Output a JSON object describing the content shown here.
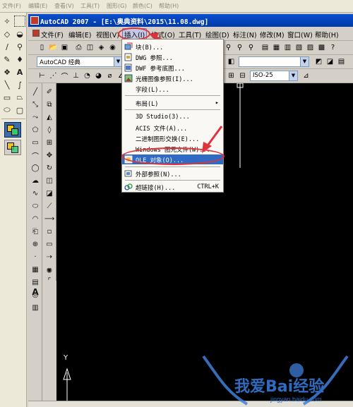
{
  "host": {
    "menu": [
      "文件(F)",
      "编辑(E)",
      "查看(V)",
      "工具(T)",
      "图形(G)",
      "颜色(C)",
      "帮助(H)"
    ]
  },
  "window": {
    "title": "AutoCAD 2007 - [E:\\奥典资料\\2015\\11.08.dwg]"
  },
  "menubar": {
    "items": [
      "文件(F)",
      "编辑(E)",
      "视图(V)",
      "插入(I)",
      "格式(O)",
      "工具(T)",
      "绘图(D)",
      "标注(N)",
      "修改(M)",
      "窗口(W)",
      "帮助(H)"
    ],
    "active_index": 3
  },
  "toolbar": {
    "workspace": "AutoCAD 经典",
    "dimstyle": "ISO-25"
  },
  "insert_menu": {
    "items": [
      {
        "label": "块(B)...",
        "icon": "block-icon"
      },
      {
        "label": "DWG 参照...",
        "icon": "dwg-reference-icon"
      },
      {
        "label": "DWF 参考底图...",
        "icon": "dwf-underlay-icon"
      },
      {
        "label": "光栅图像参照(I)...",
        "icon": "raster-image-icon"
      },
      {
        "label": "字段(L)...",
        "icon": ""
      },
      {
        "label": "布局(L)",
        "icon": "",
        "submenu": true
      },
      {
        "label": "3D Studio(3)...",
        "icon": ""
      },
      {
        "label": "ACIS 文件(A)...",
        "icon": ""
      },
      {
        "label": "二进制图形交换(E)...",
        "icon": ""
      },
      {
        "label": "Windows 图元文件(W)...",
        "icon": ""
      },
      {
        "label": "OLE 对象(O)...",
        "icon": "ole-object-icon",
        "selected": true
      },
      {
        "label": "外部参照(N)...",
        "icon": "xref-icon"
      },
      {
        "label": "超链接(H)...",
        "icon": "hyperlink-icon",
        "shortcut": "CTRL+K"
      }
    ]
  },
  "canvas": {
    "ucs_label": "Y"
  },
  "watermark": {
    "text": "我爱Bai经验",
    "url": "jingyan.baidu.com"
  },
  "colors": {
    "titlebar": "#0a4fcf",
    "selection": "#316ac5",
    "highlight_ring": "#e0323a",
    "canvas": "#000000"
  }
}
